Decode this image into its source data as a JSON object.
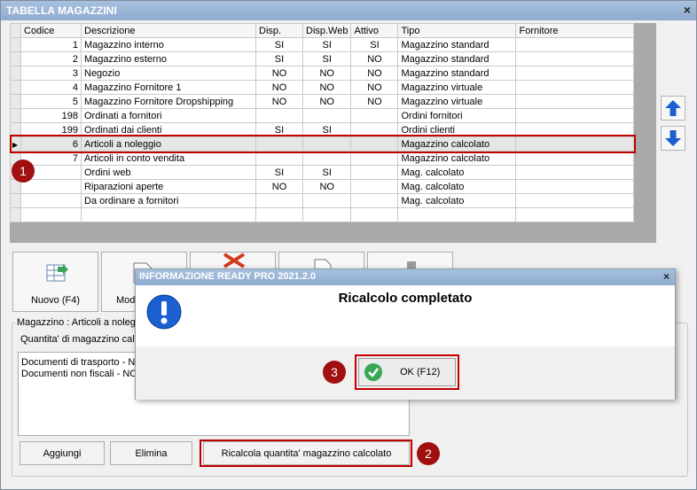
{
  "window": {
    "title": "TABELLA MAGAZZINI",
    "close_glyph": "×"
  },
  "grid": {
    "columns": [
      "Codice",
      "Descrizione",
      "Disp.",
      "Disp.Web",
      "Attivo",
      "Tipo",
      "Fornitore"
    ],
    "rows": [
      [
        "1",
        "Magazzino interno",
        "SI",
        "SI",
        "SI",
        "Magazzino standard",
        ""
      ],
      [
        "2",
        "Magazzino esterno",
        "SI",
        "SI",
        "NO",
        "Magazzino standard",
        ""
      ],
      [
        "3",
        "Negozio",
        "NO",
        "NO",
        "NO",
        "Magazzino standard",
        ""
      ],
      [
        "4",
        "Magazzino Fornitore 1",
        "NO",
        "NO",
        "NO",
        "Magazzino virtuale",
        ""
      ],
      [
        "5",
        "Magazzino Fornitore Dropshipping",
        "NO",
        "NO",
        "NO",
        "Magazzino virtuale",
        ""
      ],
      [
        "198",
        "Ordinati a fornitori",
        "",
        "",
        "",
        "Ordini fornitori",
        ""
      ],
      [
        "199",
        "Ordinati dai clienti",
        "SI",
        "SI",
        "",
        "Ordini clienti",
        ""
      ],
      [
        "6",
        "Articoli a noleggio",
        "",
        "",
        "",
        "Magazzino calcolato",
        ""
      ],
      [
        "7",
        "Articoli in conto vendita",
        "",
        "",
        "",
        "Magazzino calcolato",
        ""
      ],
      [
        "",
        "Ordini web",
        "SI",
        "SI",
        "",
        "Mag. calcolato",
        ""
      ],
      [
        "",
        "Riparazioni aperte",
        "NO",
        "NO",
        "",
        "Mag. calcolato",
        ""
      ],
      [
        "",
        "Da ordinare a fornitori",
        "",
        "",
        "",
        "Mag. calcolato",
        ""
      ],
      [
        "",
        "",
        "",
        "",
        "",
        "",
        ""
      ]
    ],
    "current_row": 7,
    "current_marker": "▶"
  },
  "side_buttons": {
    "up_icon": "arrow-up-icon",
    "down_icon": "arrow-down-icon"
  },
  "toolbar": {
    "nuovo": "Nuovo (F4)",
    "modifica_partial": "Modi"
  },
  "details": {
    "group_title": "Magazzino : Articoli a noleggio",
    "qty_label": "Quantita' di magazzino calco",
    "list_items": [
      "Documenti di trasporto - N",
      "Documenti non fiscali - NOL"
    ],
    "aggiungi": "Aggiungi",
    "elimina": "Elimina",
    "ricalcola": "Ricalcola quantita' magazzino calcolato"
  },
  "dialog": {
    "title": "INFORMAZIONE READY PRO 2021.2.0",
    "close_glyph": "×",
    "message": "Ricalcolo completato",
    "ok": "OK (F12)",
    "icon": "info-icon"
  },
  "badges": [
    "1",
    "2",
    "3"
  ],
  "colors": {
    "highlight": "#c00000",
    "badge": "#a01010",
    "title_bar": "#94b0d3",
    "info_blue": "#1b5fd1",
    "ok_green": "#3aa757"
  }
}
